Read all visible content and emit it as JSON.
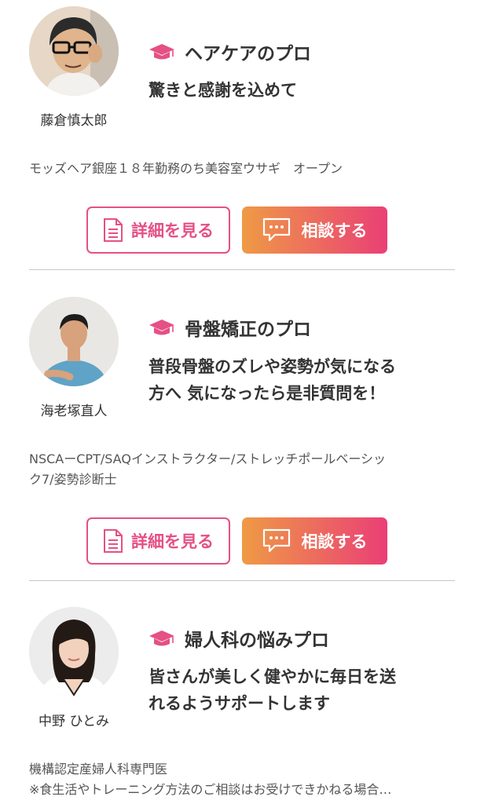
{
  "experts": [
    {
      "name": "藤倉慎太郎",
      "category": "ヘアケアのプロ",
      "catchphrase": [
        "驚きと感謝を込めて"
      ],
      "career": [
        "モッズヘア銀座１８年勤務のち美容室ウサギ　オープン"
      ],
      "detail_label": "詳細を見る",
      "consult_label": "相談する"
    },
    {
      "name": "海老塚直人",
      "category": "骨盤矯正のプロ",
      "catchphrase": [
        "普段骨盤のズレや姿勢が気になる",
        "方へ 気になったら是非質問を！"
      ],
      "career": [
        "NSCAーCPT/SAQインストラクター/ストレッチポールベーシッ",
        "ク7/姿勢診断士"
      ],
      "detail_label": "詳細を見る",
      "consult_label": "相談する"
    },
    {
      "name": "中野 ひとみ",
      "category": "婦人科の悩みプロ",
      "catchphrase": [
        "皆さんが美しく健やかに毎日を送",
        "れるようサポートします"
      ],
      "career": [
        "機構認定産婦人科専門医",
        "※食生活やトレーニング方法のご相談はお受けできかねる場合…"
      ]
    }
  ],
  "colors": {
    "accent": "#e55085",
    "gradient_start": "#ef9a45",
    "gradient_end": "#ea3f76"
  },
  "icons": {
    "category": "graduation-cap-icon",
    "detail": "document-icon",
    "consult": "chat-bubble-icon"
  }
}
